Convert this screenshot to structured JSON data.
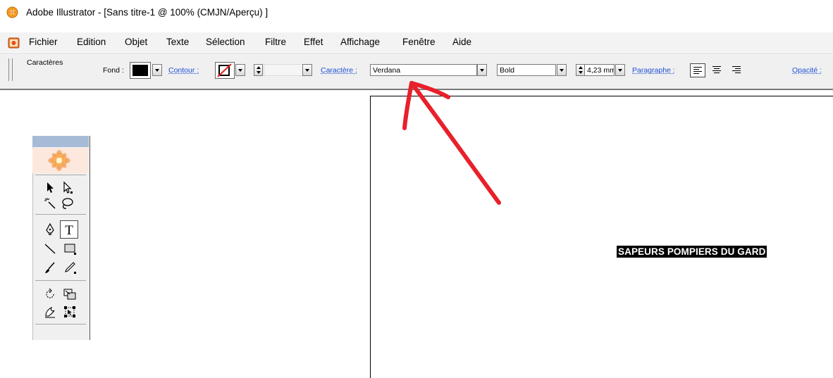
{
  "window": {
    "title": "Adobe Illustrator - [Sans titre-1 @ 100% (CMJN/Aperçu) ]"
  },
  "menu": {
    "items": [
      "Fichier",
      "Edition",
      "Objet",
      "Texte",
      "Sélection",
      "Filtre",
      "Effet",
      "Affichage",
      "Fenêtre",
      "Aide"
    ]
  },
  "control_bar": {
    "panel_label": "Caractères",
    "fill_label": "Fond :",
    "fill_color": "#000000",
    "stroke_label": "Contour :",
    "stroke_weight": "",
    "character_label": "Caractère :",
    "font_family": "Verdana",
    "font_style": "Bold",
    "font_size": "4,23 mm",
    "paragraph_label": "Paragraphe :",
    "opacity_label": "Opacité :"
  },
  "canvas": {
    "text_object": "SAPEURS POMPIERS DU GARD",
    "annotation_color": "#e8202a"
  },
  "tools": {
    "icons": [
      "selection-tool-icon",
      "direct-selection-tool-icon",
      "magic-wand-tool-icon",
      "lasso-tool-icon",
      "pen-tool-icon",
      "type-tool-icon",
      "line-tool-icon",
      "rectangle-tool-icon",
      "paintbrush-tool-icon",
      "pencil-tool-icon",
      "rotate-tool-icon",
      "scale-tool-icon",
      "warp-tool-icon",
      "free-transform-tool-icon"
    ]
  }
}
